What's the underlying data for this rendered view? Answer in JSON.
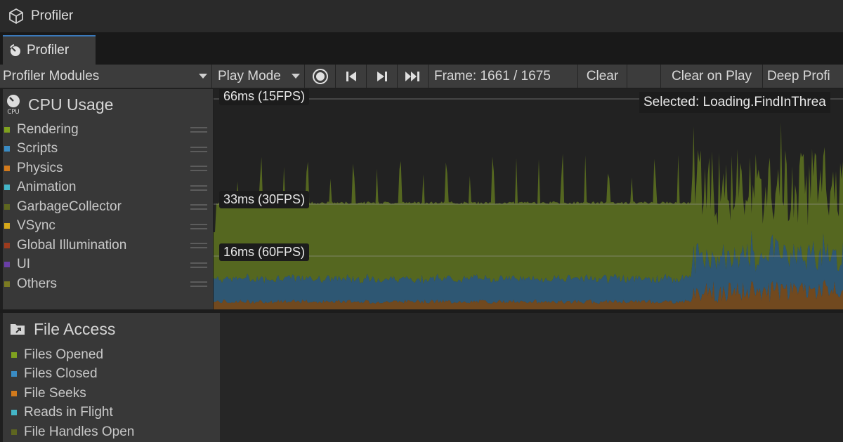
{
  "window": {
    "title": "Profiler"
  },
  "tab": {
    "label": "Profiler"
  },
  "toolbar": {
    "modules_label": "Profiler Modules",
    "play_mode_label": "Play Mode",
    "frame_label": "Frame: 1661 / 1675",
    "clear_label": "Clear",
    "clear_on_play_label": "Clear on Play",
    "deep_profile_label": "Deep Profi"
  },
  "cpu_module": {
    "title": "CPU Usage",
    "icon_text": "CPU",
    "legend": [
      {
        "label": "Rendering",
        "color": "#7fa11f"
      },
      {
        "label": "Scripts",
        "color": "#3a8cc4"
      },
      {
        "label": "Physics",
        "color": "#d27a1c"
      },
      {
        "label": "Animation",
        "color": "#44b5c7"
      },
      {
        "label": "GarbageCollector",
        "color": "#5e6620"
      },
      {
        "label": "VSync",
        "color": "#d6a81a"
      },
      {
        "label": "Global Illumination",
        "color": "#9c3b1e"
      },
      {
        "label": "UI",
        "color": "#6a3fa6"
      },
      {
        "label": "Others",
        "color": "#7b7b22"
      }
    ]
  },
  "file_module": {
    "title": "File Access",
    "legend": [
      {
        "label": "Files Opened",
        "color": "#7fa11f"
      },
      {
        "label": "Files Closed",
        "color": "#3a8cc4"
      },
      {
        "label": "File Seeks",
        "color": "#d27a1c"
      },
      {
        "label": "Reads in Flight",
        "color": "#44b5c7"
      },
      {
        "label": "File Handles Open",
        "color": "#5e6620"
      }
    ]
  },
  "chart": {
    "ref_lines": [
      {
        "ms": 66,
        "label": "66ms (15FPS)"
      },
      {
        "ms": 33,
        "label": "33ms (30FPS)"
      },
      {
        "ms": 16,
        "label": "16ms (60FPS)"
      }
    ],
    "selected_label": "Selected: Loading.FindInThrea"
  }
}
